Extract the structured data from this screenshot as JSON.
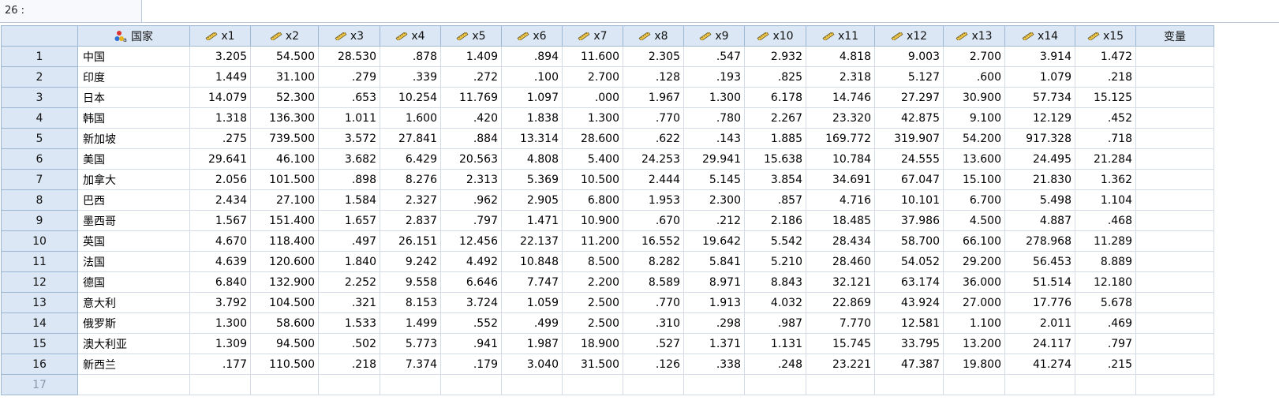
{
  "cell_ref": "26 :",
  "columns": [
    "国家",
    "x1",
    "x2",
    "x3",
    "x4",
    "x5",
    "x6",
    "x7",
    "x8",
    "x9",
    "x10",
    "x11",
    "x12",
    "x13",
    "x14",
    "x15",
    "变量"
  ],
  "column_icons": [
    "nominal-string-icon",
    "ruler-icon",
    "ruler-icon",
    "ruler-icon",
    "ruler-icon",
    "ruler-icon",
    "ruler-icon",
    "ruler-icon",
    "ruler-icon",
    "ruler-icon",
    "ruler-icon",
    "ruler-icon",
    "ruler-icon",
    "ruler-icon",
    "ruler-icon",
    "ruler-icon",
    ""
  ],
  "rows": [
    {
      "id": "1",
      "country": "中国",
      "values": [
        "3.205",
        "54.500",
        "28.530",
        ".878",
        "1.409",
        ".894",
        "11.600",
        "2.305",
        ".547",
        "2.932",
        "4.818",
        "9.003",
        "2.700",
        "3.914",
        "1.472"
      ]
    },
    {
      "id": "2",
      "country": "印度",
      "values": [
        "1.449",
        "31.100",
        ".279",
        ".339",
        ".272",
        ".100",
        "2.700",
        ".128",
        ".193",
        ".825",
        "2.318",
        "5.127",
        ".600",
        "1.079",
        ".218"
      ]
    },
    {
      "id": "3",
      "country": "日本",
      "values": [
        "14.079",
        "52.300",
        ".653",
        "10.254",
        "11.769",
        "1.097",
        ".000",
        "1.967",
        "1.300",
        "6.178",
        "14.746",
        "27.297",
        "30.900",
        "57.734",
        "15.125"
      ]
    },
    {
      "id": "4",
      "country": "韩国",
      "values": [
        "1.318",
        "136.300",
        "1.011",
        "1.600",
        ".420",
        "1.838",
        "1.300",
        ".770",
        ".780",
        "2.267",
        "23.320",
        "42.875",
        "9.100",
        "12.129",
        ".452"
      ]
    },
    {
      "id": "5",
      "country": "新加坡",
      "values": [
        ".275",
        "739.500",
        "3.572",
        "27.841",
        ".884",
        "13.314",
        "28.600",
        ".622",
        ".143",
        "1.885",
        "169.772",
        "319.907",
        "54.200",
        "917.328",
        ".718"
      ]
    },
    {
      "id": "6",
      "country": "美国",
      "values": [
        "29.641",
        "46.100",
        "3.682",
        "6.429",
        "20.563",
        "4.808",
        "5.400",
        "24.253",
        "29.941",
        "15.638",
        "10.784",
        "24.555",
        "13.600",
        "24.495",
        "21.284"
      ]
    },
    {
      "id": "7",
      "country": "加拿大",
      "values": [
        "2.056",
        "101.500",
        ".898",
        "8.276",
        "2.313",
        "5.369",
        "10.500",
        "2.444",
        "5.145",
        "3.854",
        "34.691",
        "67.047",
        "15.100",
        "21.830",
        "1.362"
      ]
    },
    {
      "id": "8",
      "country": "巴西",
      "values": [
        "2.434",
        "27.100",
        "1.584",
        "2.327",
        ".962",
        "2.905",
        "6.800",
        "1.953",
        "2.300",
        ".857",
        "4.716",
        "10.101",
        "6.700",
        "5.498",
        "1.104"
      ]
    },
    {
      "id": "9",
      "country": "墨西哥",
      "values": [
        "1.567",
        "151.400",
        "1.657",
        "2.837",
        ".797",
        "1.471",
        "10.900",
        ".670",
        ".212",
        "2.186",
        "18.485",
        "37.986",
        "4.500",
        "4.887",
        ".468"
      ]
    },
    {
      "id": "10",
      "country": "英国",
      "values": [
        "4.670",
        "118.400",
        ".497",
        "26.151",
        "12.456",
        "22.137",
        "11.200",
        "16.552",
        "19.642",
        "5.542",
        "28.434",
        "58.700",
        "66.100",
        "278.968",
        "11.289"
      ]
    },
    {
      "id": "11",
      "country": "法国",
      "values": [
        "4.639",
        "120.600",
        "1.840",
        "9.242",
        "4.492",
        "10.848",
        "8.500",
        "8.282",
        "5.841",
        "5.210",
        "28.460",
        "54.052",
        "29.200",
        "56.453",
        "8.889"
      ]
    },
    {
      "id": "12",
      "country": "德国",
      "values": [
        "6.840",
        "132.900",
        "2.252",
        "9.558",
        "6.646",
        "7.747",
        "2.200",
        "8.589",
        "8.971",
        "8.843",
        "32.121",
        "63.174",
        "36.000",
        "51.514",
        "12.180"
      ]
    },
    {
      "id": "13",
      "country": "意大利",
      "values": [
        "3.792",
        "104.500",
        ".321",
        "8.153",
        "3.724",
        "1.059",
        "2.500",
        ".770",
        "1.913",
        "4.032",
        "22.869",
        "43.924",
        "27.000",
        "17.776",
        "5.678"
      ]
    },
    {
      "id": "14",
      "country": "俄罗斯",
      "values": [
        "1.300",
        "58.600",
        "1.533",
        "1.499",
        ".552",
        ".499",
        "2.500",
        ".310",
        ".298",
        ".987",
        "7.770",
        "12.581",
        "1.100",
        "2.011",
        ".469"
      ]
    },
    {
      "id": "15",
      "country": "澳大利亚",
      "values": [
        "1.309",
        "94.500",
        ".502",
        "5.773",
        ".941",
        "1.987",
        "18.900",
        ".527",
        "1.371",
        "1.131",
        "15.745",
        "33.795",
        "13.200",
        "24.117",
        ".797"
      ]
    },
    {
      "id": "16",
      "country": "新西兰",
      "values": [
        ".177",
        "110.500",
        ".218",
        "7.374",
        ".179",
        "3.040",
        "31.500",
        ".126",
        ".338",
        ".248",
        "23.221",
        "47.387",
        "19.800",
        "41.274",
        ".215"
      ]
    }
  ],
  "empty_row_label": "17",
  "colors": {
    "header_bg": "#dbe7f5",
    "grid_line": "#d4dbe6",
    "header_border": "#9eb7d3"
  }
}
